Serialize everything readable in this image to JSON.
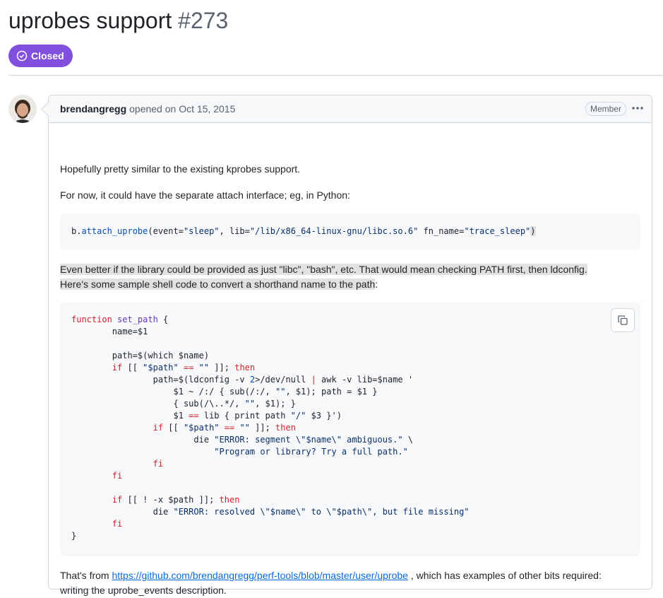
{
  "issue": {
    "title": "uprobes support",
    "number": "#273",
    "state": "Closed"
  },
  "comment": {
    "author": "brendangregg",
    "meta": "opened on Oct 15, 2015",
    "role": "Member",
    "para1": "Hopefully pretty similar to the existing kprobes support.",
    "para2": "For now, it could have the separate attach interface; eg, in Python:",
    "para3_line1": "Even better if the library could be provided as just \"libc\", \"bash\", etc. That would mean checking PATH first, then ldconfig.",
    "para3_line2": "Here's some sample shell code to convert a shorthand name to the path",
    "para3_tail": ":",
    "para4_prefix": "That's from ",
    "para4_link": "https://github.com/brendangregg/perf-tools/blob/master/user/uprobe",
    "para4_suffix": " , which has examples of other bits required:",
    "para4_line2": "writing the uprobe_events description."
  },
  "code1": {
    "obj": "b.",
    "method": "attach_uprobe",
    "open": "(event=",
    "event": "\"sleep\"",
    "lib_key": ", lib=",
    "lib": "\"/lib/x86_64-linux-gnu/libc.so.6\"",
    "fn_key": " fn_name=",
    "fn": "\"trace_sleep\"",
    "close": ")"
  },
  "code2": {
    "lines": [
      "function set_path {",
      "        name=$1",
      "",
      "        path=$(which $name)",
      "        if [[ \"$path\" == \"\" ]]; then",
      "                path=$(ldconfig -v 2>/dev/null | awk -v lib=$name '",
      "                    $1 ~ /:/ { sub(/:/, \"\", $1); path = $1 }",
      "                    { sub(/\\..*/, \"\", $1); }",
      "                    $1 == lib { print path \"/\" $3 }')",
      "                if [[ \"$path\" == \"\" ]]; then",
      "                        die \"ERROR: segment \\\"$name\\\" ambiguous.\" \\",
      "                            \"Program or library? Try a full path.\"",
      "                fi",
      "        fi",
      "",
      "        if [[ ! -x $path ]]; then",
      "                die \"ERROR: resolved \\\"$name\\\" to \\\"$path\\\", but file missing\"",
      "        fi",
      "}"
    ]
  },
  "icons": {
    "status": "issue-closed-icon",
    "menu": "kebab-horizontal-icon",
    "copy": "copy-icon"
  },
  "colors": {
    "closed": "#8250df",
    "link": "#0969da",
    "keyword": "#cf222e",
    "function": "#6639ba",
    "string": "#0a3069"
  }
}
